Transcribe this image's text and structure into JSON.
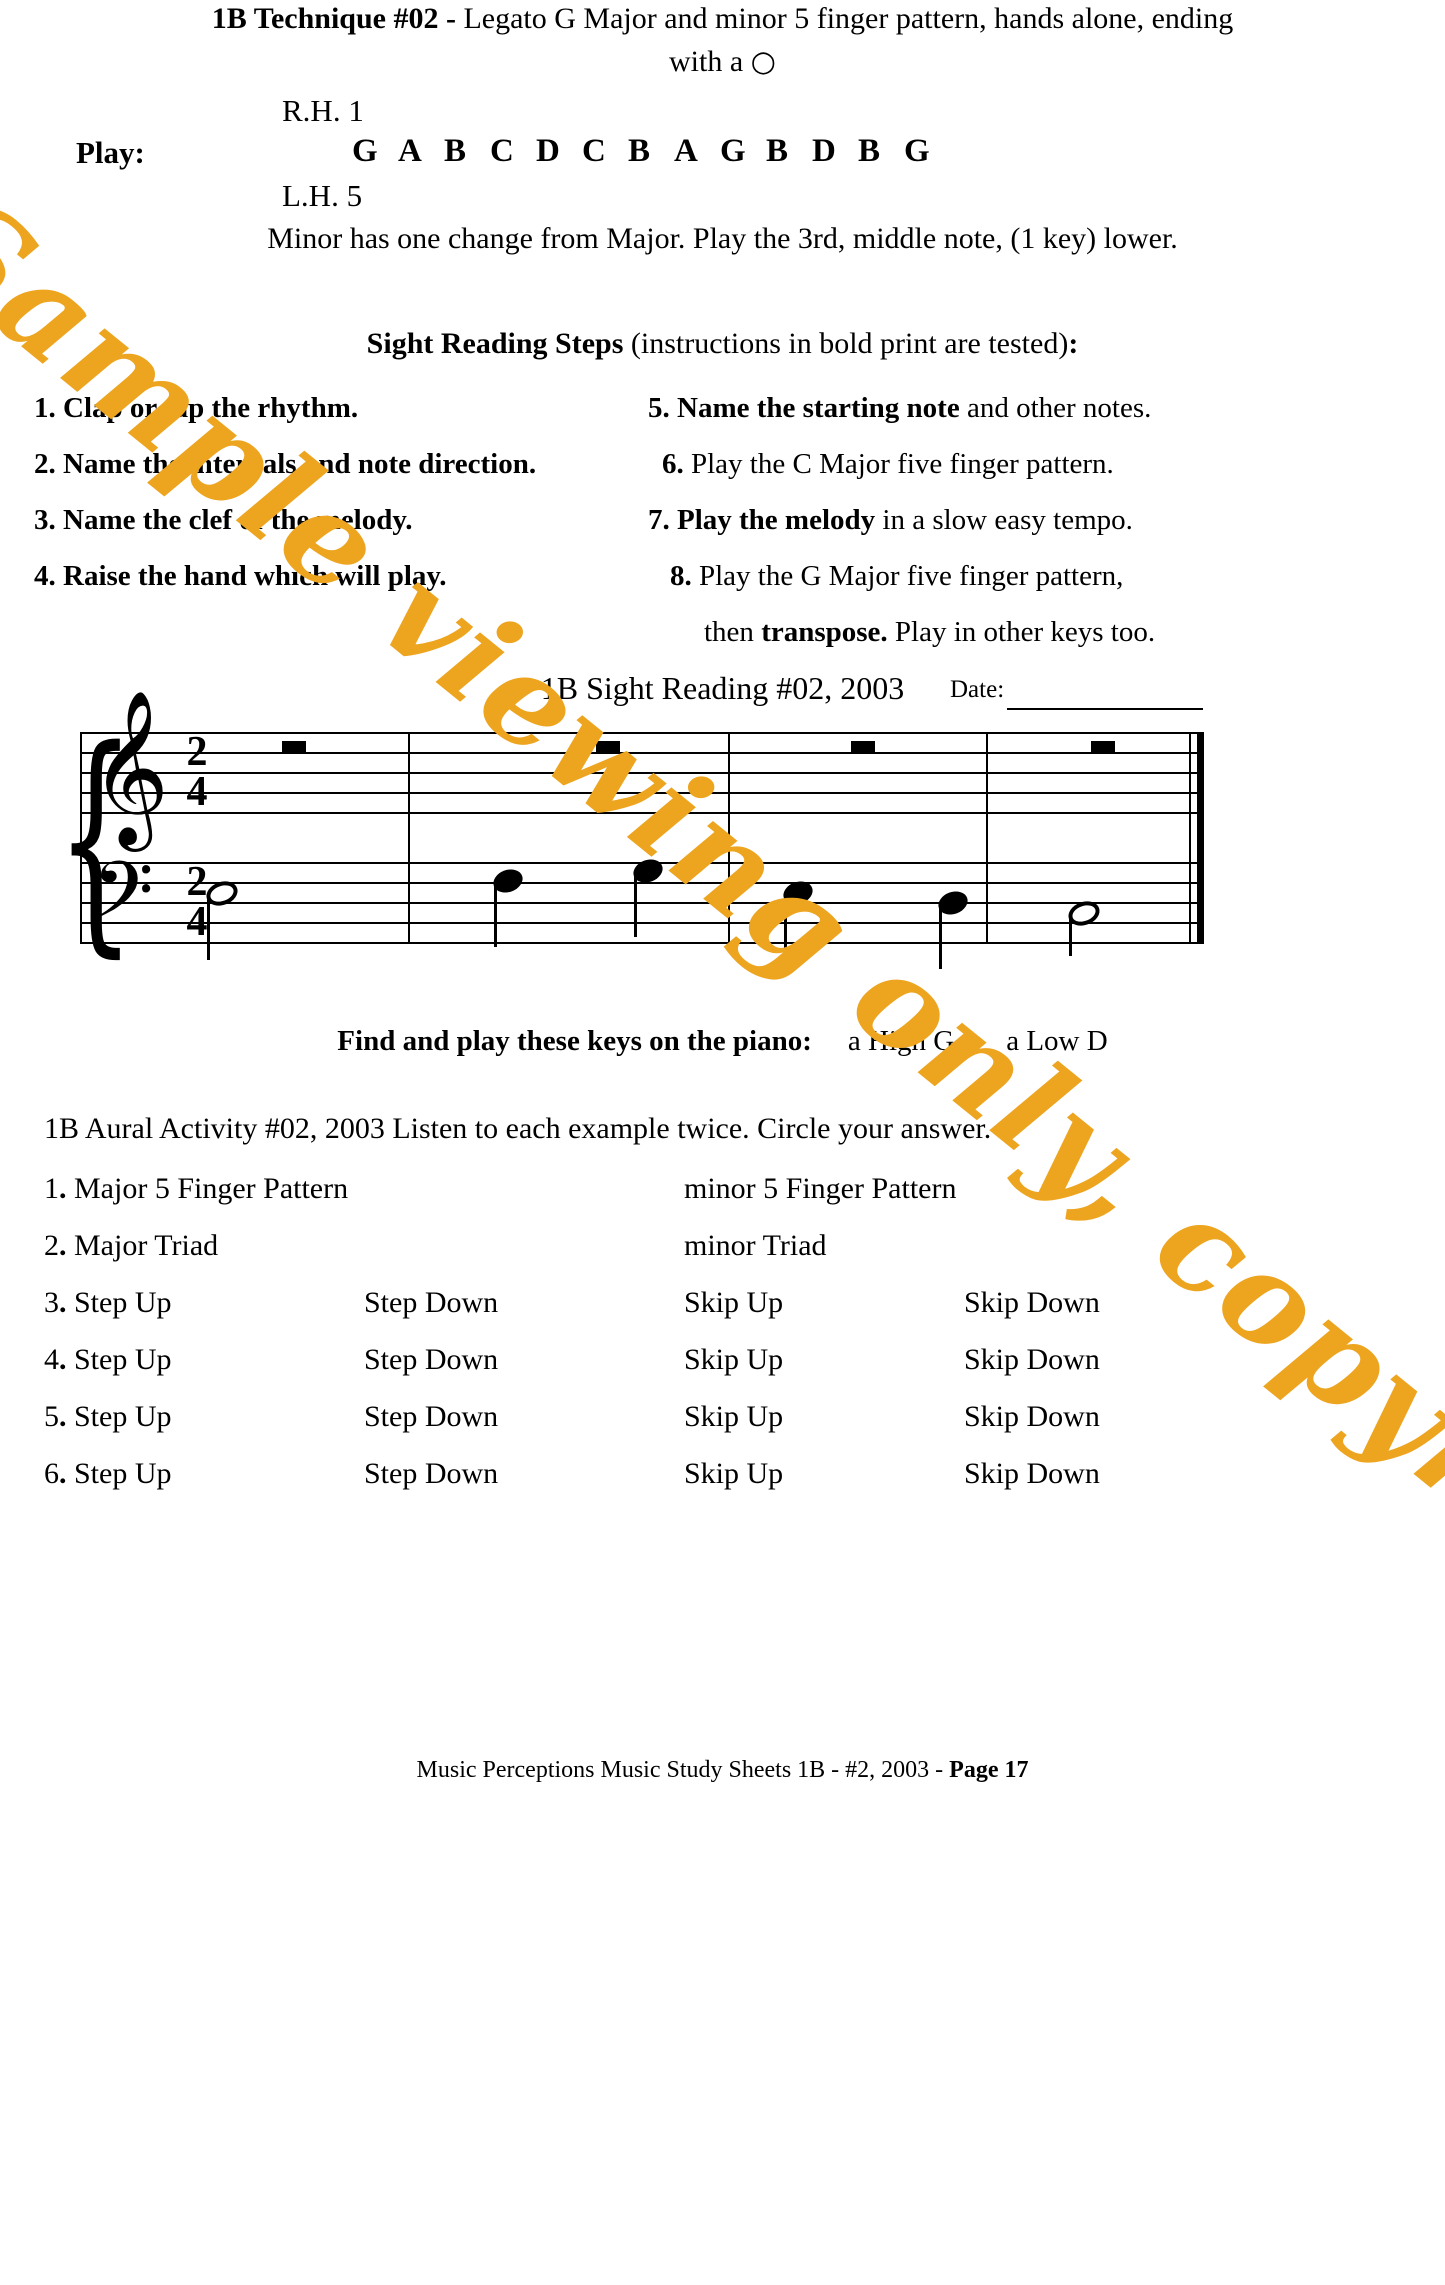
{
  "technique": {
    "line1_bold": "1B Technique #02 - ",
    "line1_rest": "Legato G Major and minor 5 finger pattern, hands alone, ending",
    "line2_prefix": "with a ",
    "line2_glyph": "○",
    "rh_label": "R.H. 1",
    "play_label": "Play:",
    "note_letters": [
      "G",
      "A",
      "B",
      "C",
      "D",
      "C",
      "B",
      "A",
      "G",
      "B",
      "D",
      "B",
      "G"
    ],
    "lh_label": "L.H. 5",
    "minor_note": "Minor has one change from Major. Play the 3rd, middle note, (1 key) lower."
  },
  "sight_reading": {
    "heading_bold": "Sight Reading Steps",
    "heading_rest": " (instructions in bold print are tested)",
    "heading_colon": ":",
    "steps_left": [
      {
        "num": "1.",
        "bold": " Clap or tap the rhythm.",
        "plain": ""
      },
      {
        "num": "2.",
        "bold": " Name the intervals and note direction.",
        "plain": ""
      },
      {
        "num": "3.",
        "bold": " Name the clef of the melody.",
        "plain": ""
      },
      {
        "num": "4.",
        "bold": " Raise the hand which will play.",
        "plain": ""
      }
    ],
    "steps_right": [
      {
        "num": "5.",
        "bold": " Name the starting note",
        "plain": " and other notes."
      },
      {
        "num": "6.",
        "bold": "",
        "plain": " Play the C Major five finger pattern."
      },
      {
        "num": "7.",
        "bold": " Play the melody",
        "plain": " in a slow easy tempo."
      },
      {
        "num": "8.",
        "bold": "",
        "plain": " Play the G Major five finger pattern,"
      }
    ],
    "step8_continuation_plain1": "then ",
    "step8_continuation_bold": "transpose.",
    "step8_continuation_plain2": " Play in other keys too."
  },
  "music": {
    "title": "1B Sight Reading #02, 2003",
    "date_label": "Date:",
    "date_value": "",
    "treble_time_top": "2",
    "treble_time_bottom": "4",
    "bass_time_top": "2",
    "bass_time_bottom": "4",
    "treble_clef_glyph": "𝄞",
    "bass_clef_glyph": "𝄢",
    "brace_glyph": "{"
  },
  "find_play": {
    "bold_text": "Find and play these keys on the piano:",
    "item1": "a High G",
    "item2": "a Low D"
  },
  "aural": {
    "heading": "1B Aural Activity #02, 2003  Listen to each example twice. Circle your answer.",
    "rows": [
      {
        "num": "1",
        "period": ".",
        "type": "pair",
        "cells": [
          "Major 5 Finger Pattern",
          "minor 5 Finger Pattern"
        ]
      },
      {
        "num": "2",
        "period": ".",
        "type": "pair",
        "cells": [
          "Major Triad",
          "minor Triad"
        ]
      },
      {
        "num": "3",
        "period": ".",
        "type": "quad",
        "cells": [
          "Step Up",
          "Step Down",
          "Skip Up",
          "Skip Down"
        ]
      },
      {
        "num": "4",
        "period": ".",
        "type": "quad",
        "cells": [
          "Step Up",
          "Step Down",
          "Skip Up",
          "Skip Down"
        ]
      },
      {
        "num": "5",
        "period": ".",
        "type": "quad",
        "cells": [
          "Step Up",
          "Step Down",
          "Skip Up",
          "Skip Down"
        ]
      },
      {
        "num": "6",
        "period": ".",
        "type": "quad",
        "cells": [
          "Step Up",
          "Step Down",
          "Skip Up",
          "Skip Down"
        ]
      }
    ]
  },
  "footer": {
    "plain": "Music Perceptions Music Study Sheets 1B - #2, 2003 - ",
    "bold": "Page 17"
  },
  "watermark": {
    "text": "Sample viewing only, copyrighted material.",
    "color": "#EDA520"
  }
}
